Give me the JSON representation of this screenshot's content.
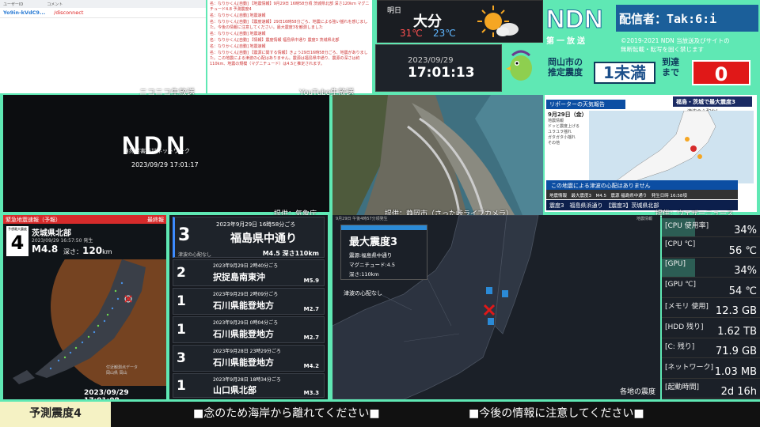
{
  "comments": {
    "col_user": "ユーザーID",
    "col_comment": "コメント",
    "rows": [
      {
        "user": "Yo9in-kVdC9...",
        "text": "/disconnect"
      }
    ],
    "service_label": "ニコニコ生放送"
  },
  "youtube": {
    "service_label": "YouTube生放送",
    "lines": [
      "名：なりかくん[自動] 【地震情報】9月29日 16時58分頃 茨城県北部 深さ120km マグニチュード4.8 予測震度4",
      "名：なりかくん[自動] 地震速報",
      "名：なりかくん[自動] 【震度速報】29日16時58分ごろ、地震による強い揺れを感じました。今後の情報に注意してください。最大震度3を観測しました",
      "名：なりかくん[自動] 地震速報",
      "名：なりかくん[自動] 【情報】震度情報 福島県中通り 震度3 茨城県北部",
      "名：なりかくん[自動] 地震速報",
      "名：なりかくん[自動] 【震源に関する情報】きょう29日16時58分ごろ、地震がありました。この地震による津波の心配はありません。震源は福島県中通り、震源の深さは約110km、地震の規模（マグニチュード）は4.5と推定されます。"
    ]
  },
  "weather": {
    "label": "明日",
    "city": "大分",
    "high": "31℃",
    "low": "23℃"
  },
  "clock": {
    "date": "2023/09/29",
    "time": "17:01:13"
  },
  "header": {
    "logo": "NDN",
    "broadcaster": "配信者：Tak:6:i",
    "first": "第一放送",
    "copyright": [
      "©2019-2021 NDN 当放送及びサイトの",
      "無断転載・転写を固く禁じます"
    ],
    "location_label": "岡山市の推定震度",
    "estimated_intensity": "1未満",
    "arrival_label": "到達まで",
    "countdown": "0"
  },
  "ndn_main": {
    "logo": "NDN",
    "subtitle": "自然災害防災ネットワーク",
    "timestamp": "2023/09/29 17:01:17"
  },
  "camera": {
    "jma_label": "提供：気象庁",
    "cam_label": "提供：静岡市（さった峠ライブカメラ）"
  },
  "weathernews": {
    "reporter": "リポーターの天気報告",
    "date": "9月29日（金） 17時00分",
    "headline": "福島・茨城で最大震度3",
    "tsunami": "津波の心配なし",
    "legend": [
      "地震情報",
      "ドッと震度上げる",
      "ユラユラ揺れ",
      "ガタガタ小揺れ",
      "その他"
    ],
    "banner": "この地震による津波の心配はありません",
    "info": "地震情報　最大震度3　M4.5　震源 福島県中通り　発生日時 16:58頃",
    "bottom": "震度3　福島県浜通り　【震度3】茨城県北部",
    "label": "提供：ウェザーニュース"
  },
  "eew": {
    "title": "緊急地震速報（予報）",
    "final": "最終報",
    "int_label": "予想最大震度",
    "intensity": "4",
    "area": "茨城県北部",
    "time": "2023/09/29 16:57:50 発生",
    "magnitude": "M4.8",
    "depth_label": "深さ：",
    "depth": "120",
    "depth_unit": "km",
    "credit": [
      "付近観測点データ",
      "岡山県 岡山"
    ],
    "footer": "2023/09/29 17:01:08"
  },
  "quakes": [
    {
      "date": "2023年9月29日 16時58分ごろ",
      "intensity": "3",
      "area": "福島県中通り",
      "mag": "M4.5 深さ110km",
      "tsunami": "津波の心配なし"
    },
    {
      "date": "2023年9月29日 2時40分ごろ",
      "intensity": "2",
      "area": "択捉島南東沖",
      "mag": "M5.9"
    },
    {
      "date": "2023年9月29日 2時09分ごろ",
      "intensity": "1",
      "area": "石川県能登地方",
      "mag": "M2.7"
    },
    {
      "date": "2023年9月29日 0時04分ごろ",
      "intensity": "1",
      "area": "石川県能登地方",
      "mag": "M2.7"
    },
    {
      "date": "2023年9月28日 23時29分ごろ",
      "intensity": "3",
      "area": "石川県能登地方",
      "mag": "M4.2"
    },
    {
      "date": "2023年9月28日 18時34分ごろ",
      "intensity": "1",
      "area": "山口県北部",
      "mag": "M3.3"
    }
  ],
  "mainmap": {
    "time": "9月29日 午後4時57分頃発生",
    "info_tag": "地震情報",
    "max": "最大震度3",
    "epicenter": "震源:福島県中通り",
    "magnitude": "マグニチュード:4.5",
    "depth": "深さ:110km",
    "tsunami": "津波の心配なし",
    "footer": "各地の震度"
  },
  "system": [
    {
      "label": "[CPU 使用率]",
      "value": "34%",
      "fill": 0.34
    },
    {
      "label": "[CPU ℃]",
      "value": "56 ℃",
      "fill": 0
    },
    {
      "label": "[GPU]",
      "value": "34%",
      "fill": 0.34
    },
    {
      "label": "[GPU ℃]",
      "value": "54 ℃",
      "fill": 0
    },
    {
      "label": "[メモリ 使用]",
      "value": "12.3 GB",
      "fill": 0
    },
    {
      "label": "[HDD 残り]",
      "value": "1.62 TB",
      "fill": 0
    },
    {
      "label": "[C: 残り]",
      "value": "71.9 GB",
      "fill": 0
    },
    {
      "label": "[ネットワーク]",
      "value": "1.03 MB",
      "fill": 0
    },
    {
      "label": "[起動時間]",
      "value": "2d 16h",
      "fill": 0
    }
  ],
  "ticker": {
    "forecast": "予測震度4",
    "messages": [
      "■念のため海岸から離れてください■",
      "■今後の情報に注意してください■"
    ]
  },
  "colors": {
    "accent": "#5fe8b4",
    "alert": "#e01818",
    "brand": "#1b5f9a"
  }
}
